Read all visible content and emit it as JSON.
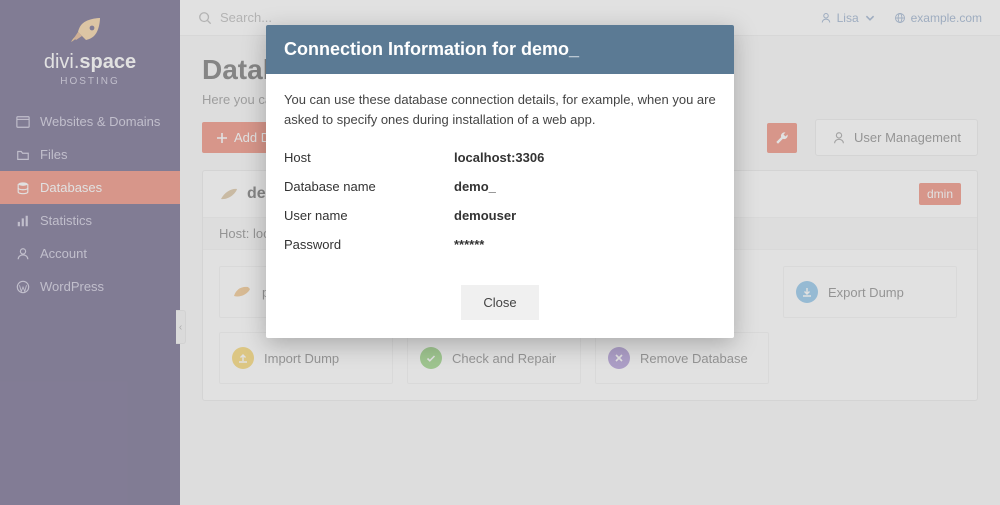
{
  "brand": {
    "pre": "divi.",
    "bold": "space",
    "sub": "HOSTING"
  },
  "search": {
    "placeholder": "Search..."
  },
  "topbar": {
    "user": "Lisa",
    "domain": "example.com"
  },
  "nav": [
    {
      "label": "Websites & Domains"
    },
    {
      "label": "Files"
    },
    {
      "label": "Databases"
    },
    {
      "label": "Statistics"
    },
    {
      "label": "Account"
    },
    {
      "label": "WordPress"
    }
  ],
  "page": {
    "title": "Databa",
    "desc": "Here you can c",
    "add_btn": "Add Databa",
    "user_mgmt": "User Management"
  },
  "db": {
    "name": "dem",
    "admin_badge": "dmin",
    "host_line": "Host: localh",
    "actions": {
      "php": "php",
      "export": "Export Dump",
      "import": "Import Dump",
      "check": "Check and Repair",
      "remove": "Remove Database"
    }
  },
  "modal": {
    "title": "Connection Information for demo_",
    "desc": "You can use these database connection details, for example, when you are asked to specify ones during installation of a web app.",
    "rows": [
      {
        "label": "Host",
        "value": "localhost:3306"
      },
      {
        "label": "Database name",
        "value": "demo_"
      },
      {
        "label": "User name",
        "value": "demouser"
      },
      {
        "label": "Password",
        "value": "******"
      }
    ],
    "close": "Close"
  }
}
